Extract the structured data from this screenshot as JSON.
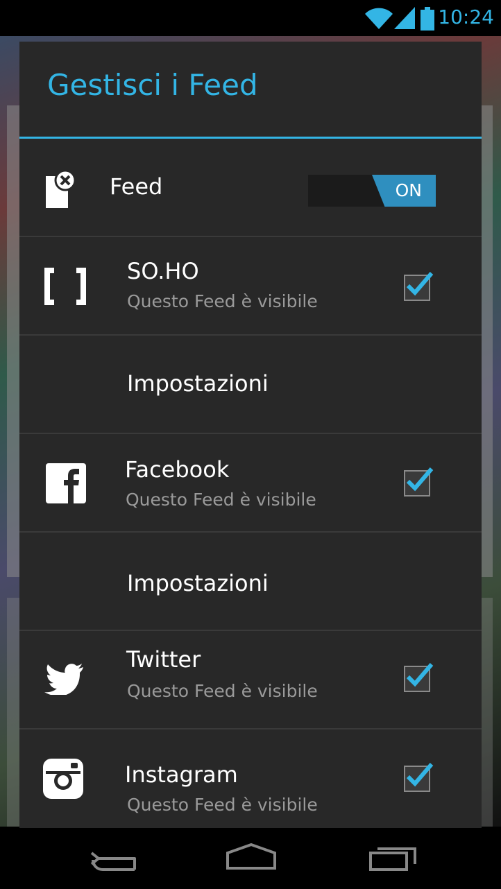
{
  "status_bar": {
    "time": "10:24"
  },
  "dialog": {
    "title": "Gestisci i Feed",
    "master_toggle": {
      "label": "Feed",
      "state": "ON"
    },
    "items": [
      {
        "name": "SO.HO",
        "subtitle": "Questo Feed è visibile",
        "checked": true,
        "icon": "soho-brackets-icon"
      },
      {
        "settings_label": "Impostazioni"
      },
      {
        "name": "Facebook",
        "subtitle": "Questo Feed è visibile",
        "checked": true,
        "icon": "facebook-icon"
      },
      {
        "settings_label": "Impostazioni"
      },
      {
        "name": "Twitter",
        "subtitle": "Questo Feed è visibile",
        "checked": true,
        "icon": "twitter-icon"
      },
      {
        "name": "Instagram",
        "subtitle": "Questo Feed è visibile",
        "checked": true,
        "icon": "instagram-icon"
      }
    ]
  },
  "colors": {
    "accent": "#33b5e5",
    "dialog_bg": "#282828",
    "divider": "#3a3a3a"
  }
}
